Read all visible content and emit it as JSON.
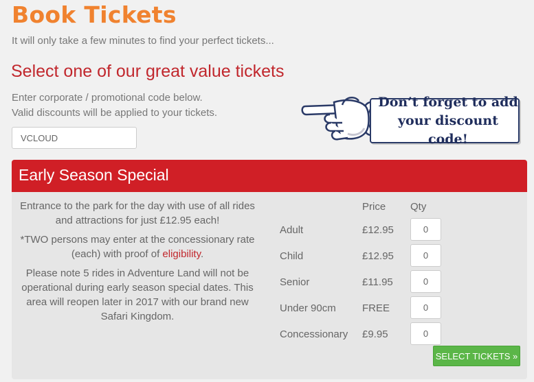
{
  "page": {
    "title": "Book Tickets",
    "subtitle": "It will only take a few minutes to find your perfect tickets..."
  },
  "promo": {
    "heading": "Select one of our great value tickets",
    "help_line1": "Enter corporate / promotional code below.",
    "help_line2": "Valid discounts will be applied to your tickets.",
    "code_value": "VCLOUD",
    "callout_line1": "Don’t forget to add",
    "callout_line2": "your discount code!",
    "callout_icon": "pointing-hand-icon"
  },
  "ticket_panel": {
    "title": "Early Season Special",
    "desc1": "Entrance to the park for the day with use of all rides and attractions for just £12.95 each!",
    "desc2_before": "*TWO persons may enter at the concessionary rate (each) with proof of ",
    "desc2_link": "eligibility",
    "desc2_after": ".",
    "desc3": "Please note 5 rides in Adventure Land will not be operational during early season special dates. This area will reopen later in 2017 with our brand new Safari Kingdom.",
    "price_header": "Price",
    "qty_header": "Qty",
    "tickets": [
      {
        "label": "Adult",
        "price": "£12.95",
        "qty": "0"
      },
      {
        "label": "Child",
        "price": "£12.95",
        "qty": "0"
      },
      {
        "label": "Senior",
        "price": "£11.95",
        "qty": "0"
      },
      {
        "label": "Under 90cm",
        "price": "FREE",
        "qty": "0"
      },
      {
        "label": "Concessionary",
        "price": "£9.95",
        "qty": "0"
      }
    ],
    "select_button": "SELECT TICKETS »"
  },
  "colors": {
    "title_orange": "#f0822f",
    "accent_red": "#d01f26",
    "button_green": "#5bb648",
    "callout_navy": "#1f2d5c"
  }
}
